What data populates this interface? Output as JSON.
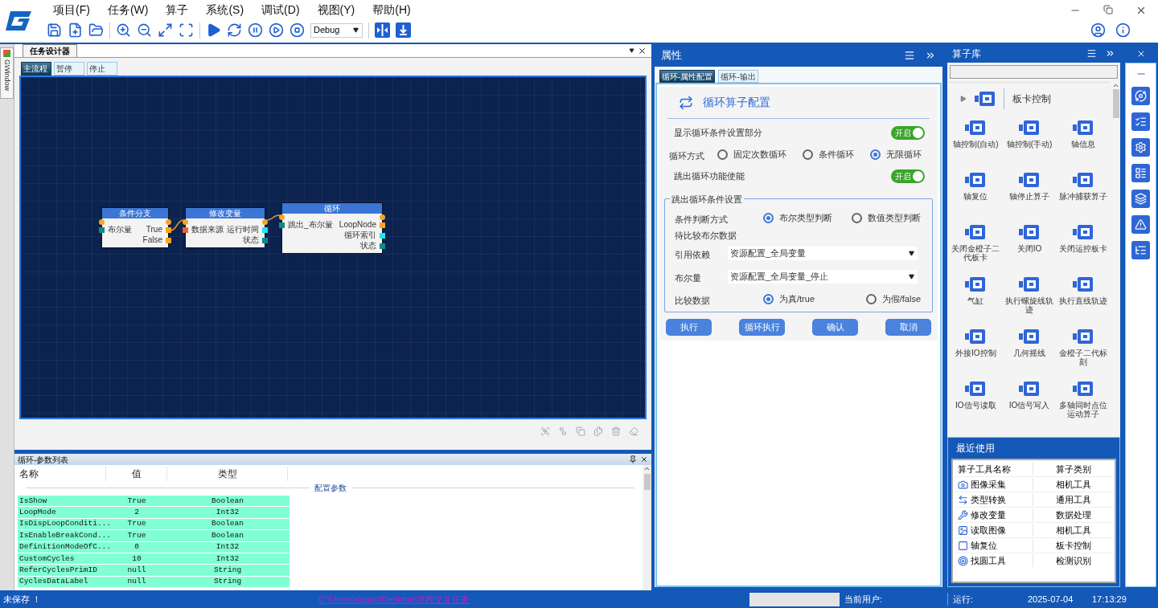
{
  "menu": [
    "项目(F)",
    "任务(W)",
    "算子",
    "系统(S)",
    "调试(D)",
    "视图(Y)",
    "帮助(H)"
  ],
  "toolbar": {
    "mode": "Debug"
  },
  "side_tab": "GWindow",
  "designer": {
    "title": "任务设计器",
    "tabs": [
      {
        "label": "主流程",
        "selected": true
      },
      {
        "label": "暂停",
        "selected": false
      },
      {
        "label": "停止",
        "selected": false
      }
    ],
    "nodes": [
      {
        "title": "条件分支",
        "rows": [
          {
            "left": "布尔量",
            "left_port": {
              "color": "#0e8b85"
            },
            "right": "True",
            "right_port": {
              "color": "#f5a623"
            }
          },
          {
            "right": "False",
            "right_port": {
              "color": "#f5a623"
            }
          }
        ]
      },
      {
        "title": "修改变量",
        "rows": [
          {
            "left": "数据来源",
            "left_port": {
              "color": "#e8652a"
            },
            "right": "运行时间",
            "right_port": {
              "color": "#22e6ee"
            }
          },
          {
            "right": "状态",
            "right_port": {
              "color": "#0e8b85"
            }
          }
        ]
      },
      {
        "title": "循环",
        "rows": [
          {
            "left": "跳出_布尔量",
            "left_port": {
              "color": "#0e8b85"
            },
            "right": "LoopNode",
            "right_port": {
              "color": "#f5a623"
            }
          },
          {
            "right": "循环索引",
            "right_port": {
              "color": "#22e6ee"
            }
          },
          {
            "right": "状态",
            "right_port": {
              "color": "#0e8b85"
            }
          }
        ]
      }
    ]
  },
  "params": {
    "title": "循环-参数列表",
    "columns": [
      "名称",
      "值",
      "类型"
    ],
    "group": "配置参数",
    "rows": [
      {
        "name": "IsShow",
        "value": "True",
        "type": "Boolean"
      },
      {
        "name": "LoopMode",
        "value": "2",
        "type": "Int32"
      },
      {
        "name": "IsDispLoopConditi...",
        "value": "True",
        "type": "Boolean"
      },
      {
        "name": "IsEnableBreakCond...",
        "value": "True",
        "type": "Boolean"
      },
      {
        "name": "DefinitionModeOfC...",
        "value": "0",
        "type": "Int32"
      },
      {
        "name": "CustomCycles",
        "value": "10",
        "type": "Int32"
      },
      {
        "name": "ReferCyclesPrimID",
        "value": "null",
        "type": "String"
      },
      {
        "name": "CyclesDataLabel",
        "value": "null",
        "type": "String"
      }
    ]
  },
  "properties": {
    "title": "属性",
    "tabs": [
      {
        "label": "循环-属性配置",
        "selected": true
      },
      {
        "label": "循环-输出",
        "selected": false
      }
    ],
    "heading": "循环算子配置",
    "rows": [
      {
        "kind": "toggle",
        "label": "显示循环条件设置部分",
        "text": "开启",
        "on": true
      },
      {
        "kind": "radio",
        "label": "循环方式",
        "options": [
          {
            "label": "固定次数循环",
            "selected": false
          },
          {
            "label": "条件循环",
            "selected": false
          },
          {
            "label": "无限循环",
            "selected": true
          }
        ]
      },
      {
        "kind": "toggle",
        "label": "跳出循环功能使能",
        "text": "开启",
        "on": true
      }
    ],
    "group": {
      "title": "跳出循环条件设置",
      "rows": [
        {
          "kind": "radio",
          "label": "条件判断方式",
          "options": [
            {
              "label": "布尔类型判断",
              "selected": true
            },
            {
              "label": "数值类型判断",
              "selected": false
            }
          ]
        },
        {
          "kind": "text",
          "label": "待比较布尔数据"
        },
        {
          "kind": "select",
          "label": "引用依赖",
          "value": "资源配置_全局变量"
        },
        {
          "kind": "select",
          "label": "布尔量",
          "value": "资源配置_全局变量_停止"
        },
        {
          "kind": "radio",
          "label": "比较数据",
          "options": [
            {
              "label": "为真/true",
              "selected": true
            },
            {
              "label": "为假/false",
              "selected": false
            }
          ]
        }
      ]
    },
    "buttons": [
      "执行",
      "循环执行",
      "确认",
      "取消"
    ]
  },
  "library": {
    "title": "算子库",
    "category": "板卡控制",
    "items": [
      "轴控制(自动)",
      "轴控制(手动)",
      "轴信息",
      "轴复位",
      "轴停止算子",
      "脉冲捕获算子",
      "关闭金橙子二代板卡",
      "关闭IO",
      "关闭运控板卡",
      "气缸",
      "执行螺旋线轨迹",
      "执行直线轨迹",
      "外接IO控制",
      "几何摇线",
      "金橙子二代标刻",
      "IO信号读取",
      "IO信号写入",
      "多轴同时点位运动算子"
    ]
  },
  "recent": {
    "title": "最近使用",
    "columns": [
      "算子工具名称",
      "算子类别"
    ],
    "rows": [
      {
        "name": "图像采集",
        "category": "相机工具"
      },
      {
        "name": "类型转换",
        "category": "通用工具"
      },
      {
        "name": "修改变量",
        "category": "数据处理"
      },
      {
        "name": "读取图像",
        "category": "相机工具"
      },
      {
        "name": "轴复位",
        "category": "板卡控制"
      },
      {
        "name": "找圆工具",
        "category": "检测识别"
      }
    ]
  },
  "status_bar": {
    "save_state": "未保存 ！",
    "path": "C:\\Users\\suppo\\Desktop\\流程交互任务",
    "user_label": "当前用户:",
    "run_label": "运行:",
    "date": "2025-07-04",
    "time": "17:13:29"
  }
}
